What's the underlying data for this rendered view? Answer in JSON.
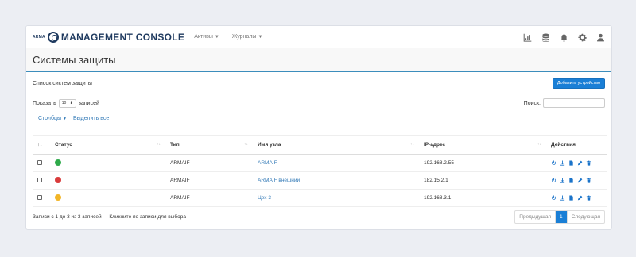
{
  "brand": {
    "small": "ARMA",
    "title": "MANAGEMENT CONSOLE"
  },
  "menu": [
    {
      "label": "Активы"
    },
    {
      "label": "Журналы"
    }
  ],
  "nav_icons": [
    "chart-icon",
    "database-icon",
    "bell-icon",
    "gear-icon",
    "user-icon"
  ],
  "page": {
    "title": "Системы защиты"
  },
  "panel": {
    "title": "Список систем защиты",
    "add_button": "Добавить устройство"
  },
  "controls": {
    "show_label": "Показать",
    "page_size": "10",
    "entries_label": "записей",
    "search_label": "Поиск:"
  },
  "links": {
    "columns": "Столбцы",
    "select_all": "Выделить все"
  },
  "table": {
    "headers": {
      "status": "Статус",
      "type": "Тип",
      "host": "Имя узла",
      "ip": "IP-адрес",
      "actions": "Действия"
    },
    "rows": [
      {
        "status_color": "#2eaa4a",
        "type": "ARMAIF",
        "host": "ARMAIF",
        "ip": "192.168.2.55"
      },
      {
        "status_color": "#d93b3b",
        "type": "ARMAIF",
        "host": "ARMAIF внешний",
        "ip": "182.15.2.1"
      },
      {
        "status_color": "#f2b526",
        "type": "ARMAIF",
        "host": "Цех 3",
        "ip": "192.168.3.1"
      }
    ]
  },
  "footer": {
    "info": "Записи с 1 до 3 из 3 записей",
    "hint": "Кликните по записи для выбора",
    "prev": "Предыдущая",
    "page": "1",
    "next": "Следующая"
  }
}
